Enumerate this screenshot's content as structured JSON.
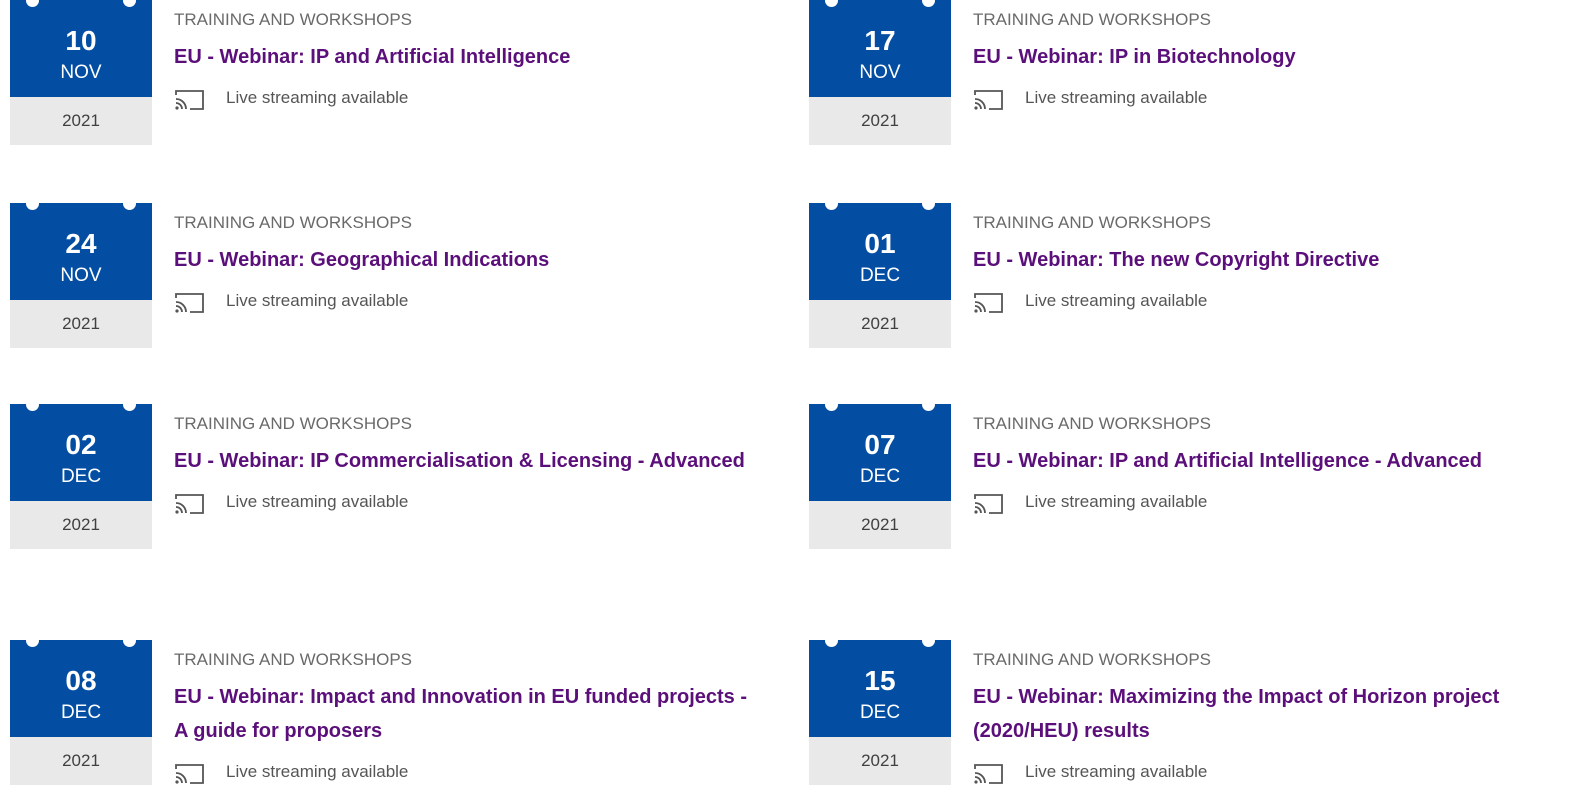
{
  "events": [
    {
      "category": "TRAINING AND WORKSHOPS",
      "day": "10",
      "month": "NOV",
      "year": "2021",
      "title": "EU - Webinar: IP and Artificial Intelligence",
      "stream": "Live streaming available"
    },
    {
      "category": "TRAINING AND WORKSHOPS",
      "day": "17",
      "month": "NOV",
      "year": "2021",
      "title": "EU - Webinar: IP in Biotechnology",
      "stream": "Live streaming available"
    },
    {
      "category": "TRAINING AND WORKSHOPS",
      "day": "24",
      "month": "NOV",
      "year": "2021",
      "title": "EU - Webinar: Geographical Indications",
      "stream": "Live streaming available"
    },
    {
      "category": "TRAINING AND WORKSHOPS",
      "day": "01",
      "month": "DEC",
      "year": "2021",
      "title": "EU - Webinar: The new Copyright Directive",
      "stream": "Live streaming available"
    },
    {
      "category": "TRAINING AND WORKSHOPS",
      "day": "02",
      "month": "DEC",
      "year": "2021",
      "title": "EU - Webinar: IP Commercialisation & Licensing - Advanced",
      "stream": "Live streaming available"
    },
    {
      "category": "TRAINING AND WORKSHOPS",
      "day": "07",
      "month": "DEC",
      "year": "2021",
      "title": "EU - Webinar: IP and Artificial Intelligence - Advanced",
      "stream": "Live streaming available"
    },
    {
      "category": "TRAINING AND WORKSHOPS",
      "day": "08",
      "month": "DEC",
      "year": "2021",
      "title": "EU - Webinar: Impact and Innovation in EU funded projects - A guide for proposers",
      "stream": "Live streaming available"
    },
    {
      "category": "TRAINING AND WORKSHOPS",
      "day": "15",
      "month": "DEC",
      "year": "2021",
      "title": "EU - Webinar: Maximizing the Impact of Horizon project (2020/HEU) results",
      "stream": "Live streaming available"
    }
  ],
  "icons": {
    "stream": "cast-icon"
  },
  "colors": {
    "calendar_header": "#034ea2",
    "calendar_year_bg": "#e9e9e9",
    "title_link": "#5b0f7a",
    "category_text": "#6a6a6a"
  }
}
